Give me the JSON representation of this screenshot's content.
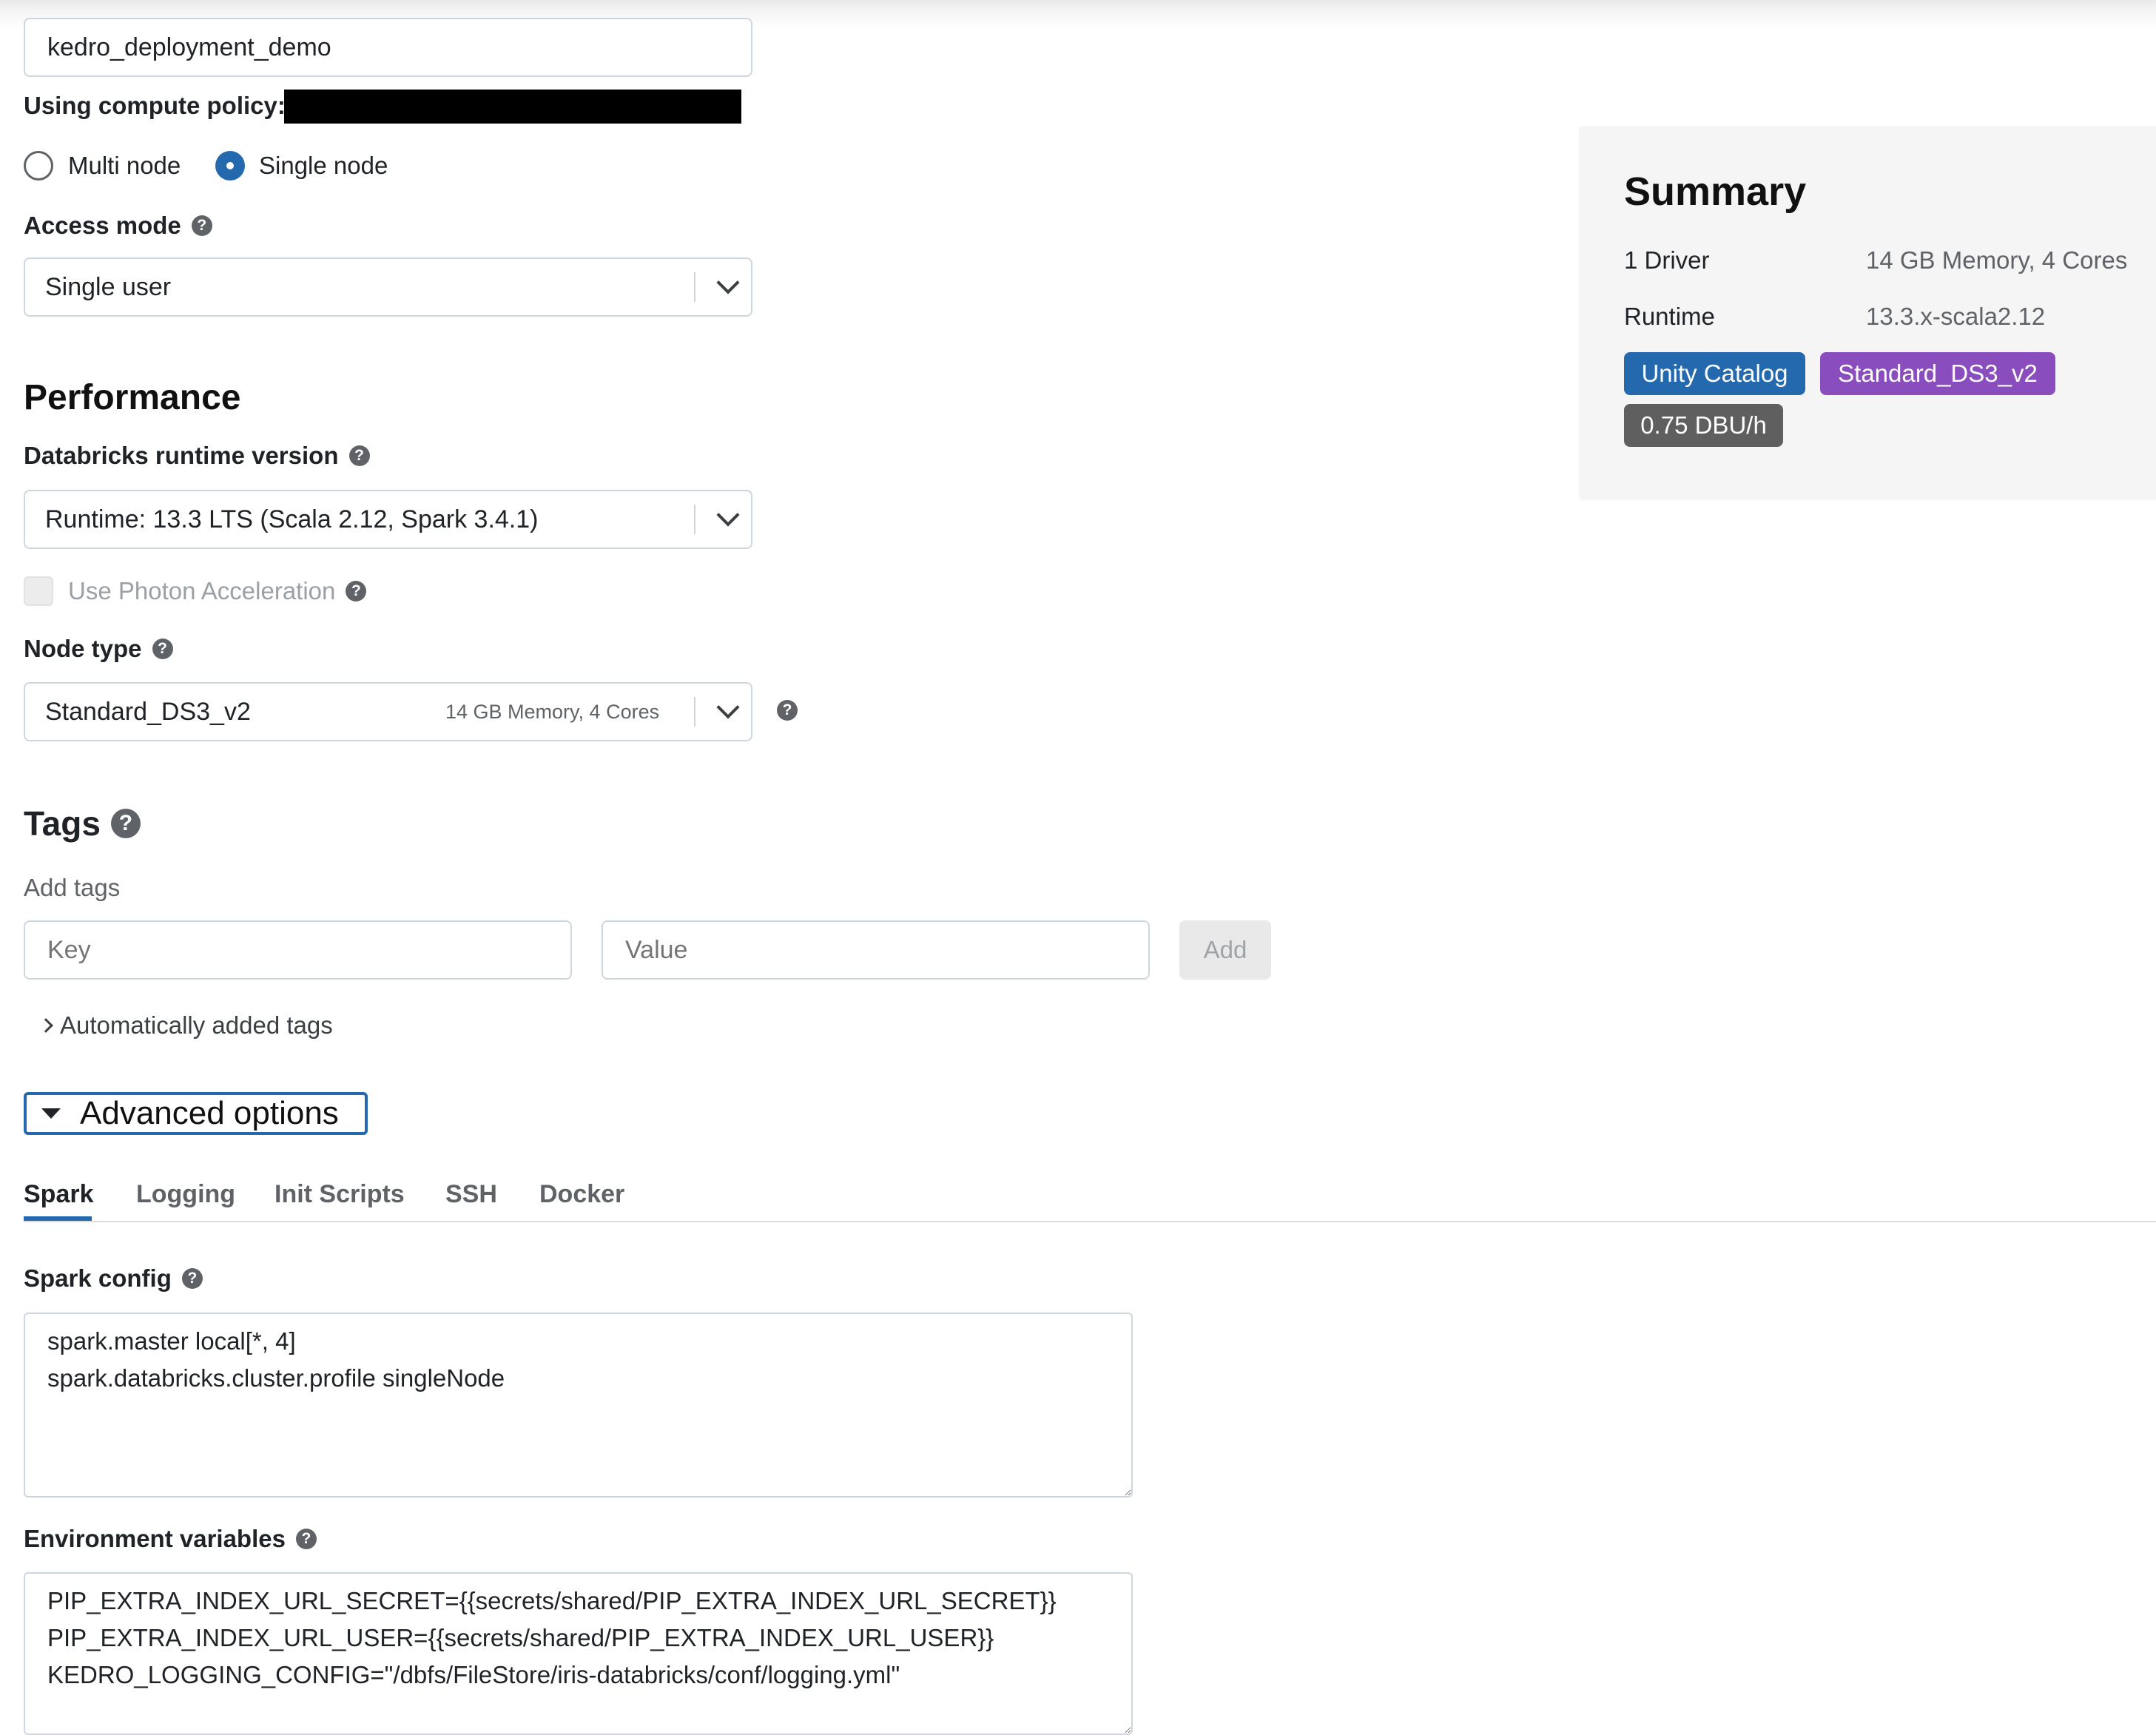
{
  "cluster_name": {
    "value": "kedro_deployment_demo"
  },
  "policy": {
    "label": "Using compute policy:"
  },
  "node_mode": {
    "multi_label": "Multi node",
    "single_label": "Single node",
    "selected": "single"
  },
  "access_mode": {
    "label": "Access mode",
    "value": "Single user"
  },
  "performance": {
    "heading": "Performance",
    "runtime_label": "Databricks runtime version",
    "runtime_value": "Runtime: 13.3 LTS (Scala 2.12, Spark 3.4.1)",
    "photon_label": "Use Photon Acceleration",
    "node_type_label": "Node type",
    "node_type_value": "Standard_DS3_v2",
    "node_type_detail": "14 GB Memory, 4 Cores"
  },
  "tags": {
    "heading": "Tags",
    "add_label": "Add tags",
    "key_placeholder": "Key",
    "value_placeholder": "Value",
    "add_button": "Add",
    "auto_tags": "Automatically added tags"
  },
  "advanced": {
    "toggle_label": "Advanced options",
    "tabs": [
      "Spark",
      "Logging",
      "Init Scripts",
      "SSH",
      "Docker"
    ],
    "active_tab": "Spark",
    "spark_config_label": "Spark config",
    "spark_config_value": "spark.master local[*, 4]\nspark.databricks.cluster.profile singleNode",
    "env_label": "Environment variables",
    "env_value": "PIP_EXTRA_INDEX_URL_SECRET={{secrets/shared/PIP_EXTRA_INDEX_URL_SECRET}}\nPIP_EXTRA_INDEX_URL_USER={{secrets/shared/PIP_EXTRA_INDEX_URL_USER}}\nKEDRO_LOGGING_CONFIG=\"/dbfs/FileStore/iris-databricks/conf/logging.yml\""
  },
  "summary": {
    "heading": "Summary",
    "driver_label": "1 Driver",
    "driver_value": "14 GB Memory, 4 Cores",
    "runtime_label": "Runtime",
    "runtime_value": "13.3.x-scala2.12",
    "badges": [
      {
        "text": "Unity Catalog",
        "color": "#2468ad"
      },
      {
        "text": "Standard_DS3_v2",
        "color": "#8a4dbd"
      },
      {
        "text": "0.75 DBU/h",
        "color": "#5f5f5f"
      }
    ]
  },
  "colors": {
    "accent": "#2468ad",
    "summary_bg": "#f5f5f5",
    "border": "#cfd6dd"
  }
}
